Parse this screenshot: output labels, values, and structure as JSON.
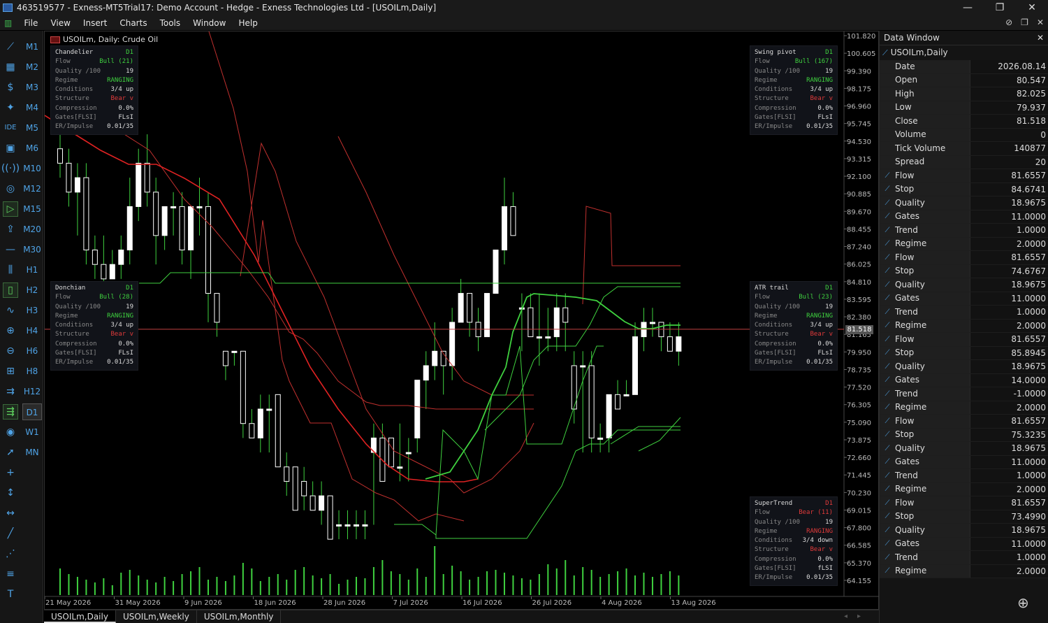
{
  "window": {
    "title": "463519577 - Exness-MT5Trial17: Demo Account - Hedge - Exness Technologies Ltd - [USOILm,Daily]",
    "controls": [
      "—",
      "❐",
      "✕"
    ]
  },
  "menu": {
    "items": [
      "File",
      "View",
      "Insert",
      "Charts",
      "Tools",
      "Window",
      "Help"
    ]
  },
  "toolbar": {
    "timeframes": [
      "M1",
      "M2",
      "M3",
      "M4",
      "M5",
      "M6",
      "M10",
      "M12",
      "M15",
      "M20",
      "M30",
      "H1",
      "H2",
      "H3",
      "H4",
      "H6",
      "H8",
      "H12",
      "D1",
      "W1",
      "MN"
    ],
    "active_timeframe": "D1",
    "ide_label": "IDE"
  },
  "chart": {
    "symbol_label": "USOILm, Daily:  Crude Oil",
    "current_price": "81.518",
    "price_labels": [
      "101.820",
      "100.605",
      "99.390",
      "98.175",
      "96.960",
      "95.745",
      "94.530",
      "93.315",
      "92.100",
      "90.885",
      "89.670",
      "88.455",
      "87.240",
      "86.025",
      "84.810",
      "83.595",
      "82.380",
      "81.165",
      "79.950",
      "78.735",
      "77.520",
      "76.305",
      "75.090",
      "73.875",
      "72.660",
      "71.445",
      "70.230",
      "69.015",
      "67.800",
      "66.585",
      "65.370",
      "64.155"
    ],
    "date_labels": [
      "21 May 2026",
      "31 May 2026",
      "9 Jun 2026",
      "18 Jun 2026",
      "28 Jun 2026",
      "7 Jul 2026",
      "16 Jul 2026",
      "26 Jul 2026",
      "4 Aug 2026",
      "13 Aug 2026"
    ],
    "colors": {
      "bull": "#ffffff",
      "bear": "#ffffff",
      "wick": "#3fd13f",
      "red_line": "#e03a3a",
      "green_line": "#3fd13f",
      "volume": "#3fd13f"
    }
  },
  "panels": [
    {
      "title": "Chandelier",
      "tf": "D1",
      "flow": "Bull (21)",
      "flow_color": "green",
      "quality": "19",
      "regime": "RANGING",
      "regime_color": "green",
      "conditions": "3/4 up",
      "structure": "Bear v",
      "compression": "0.0%",
      "gates": "FLsI",
      "er": "0.01/35"
    },
    {
      "title": "Swing pivot",
      "tf": "D1",
      "flow": "Bull (167)",
      "flow_color": "green",
      "quality": "19",
      "regime": "RANGING",
      "regime_color": "green",
      "conditions": "3/4 up",
      "structure": "Bear v",
      "compression": "0.0%",
      "gates": "FLsI",
      "er": "0.01/35"
    },
    {
      "title": "Donchian",
      "tf": "D1",
      "flow": "Bull (28)",
      "flow_color": "green",
      "quality": "19",
      "regime": "RANGING",
      "regime_color": "green",
      "conditions": "3/4 up",
      "structure": "Bear v",
      "compression": "0.0%",
      "gates": "FLsI",
      "er": "0.01/35"
    },
    {
      "title": "ATR trail",
      "tf": "D1",
      "flow": "Bull (23)",
      "flow_color": "green",
      "quality": "19",
      "regime": "RANGING",
      "regime_color": "green",
      "conditions": "3/4 up",
      "structure": "Bear v",
      "compression": "0.0%",
      "gates": "FLsI",
      "er": "0.01/35"
    },
    {
      "title": "SuperTrend",
      "tf": "D1",
      "flow": "Bear (11)",
      "flow_color": "red",
      "quality": "19",
      "regime": "RANGING",
      "regime_color": "red",
      "conditions": "3/4 down",
      "structure": "Bear v",
      "compression": "0.0%",
      "gates": "fLSI",
      "er": "0.01/35"
    }
  ],
  "panel_labels": {
    "flow": "Flow",
    "quality": "Quality /100",
    "regime": "Regime",
    "conditions": "Conditions",
    "structure": "Structure",
    "compression": "Compression",
    "gates": "Gates[FLSI]",
    "er": "ER/Impulse"
  },
  "tabs": [
    "USOILm,Daily",
    "USOILm,Weekly",
    "USOILm,Monthly"
  ],
  "data_window": {
    "title": "Data Window",
    "close": "✕",
    "symbol": "USOILm,Daily",
    "rows": [
      {
        "k": "Date",
        "v": "2026.08.14",
        "icon": ""
      },
      {
        "k": "Open",
        "v": "80.547",
        "icon": ""
      },
      {
        "k": "High",
        "v": "82.025",
        "icon": ""
      },
      {
        "k": "Low",
        "v": "79.937",
        "icon": ""
      },
      {
        "k": "Close",
        "v": "81.518",
        "icon": ""
      },
      {
        "k": "Volume",
        "v": "0",
        "icon": ""
      },
      {
        "k": "Tick Volume",
        "v": "140877",
        "icon": ""
      },
      {
        "k": "Spread",
        "v": "20",
        "icon": ""
      },
      {
        "k": "Flow",
        "v": "81.6557",
        "icon": "ind"
      },
      {
        "k": "Stop",
        "v": "84.6741",
        "icon": "ind"
      },
      {
        "k": "Quality",
        "v": "18.9675",
        "icon": "ind"
      },
      {
        "k": "Gates",
        "v": "11.0000",
        "icon": "ind"
      },
      {
        "k": "Trend",
        "v": "1.0000",
        "icon": "ind"
      },
      {
        "k": "Regime",
        "v": "2.0000",
        "icon": "ind"
      },
      {
        "k": "Flow",
        "v": "81.6557",
        "icon": "ind"
      },
      {
        "k": "Stop",
        "v": "74.6767",
        "icon": "ind"
      },
      {
        "k": "Quality",
        "v": "18.9675",
        "icon": "ind"
      },
      {
        "k": "Gates",
        "v": "11.0000",
        "icon": "ind"
      },
      {
        "k": "Trend",
        "v": "1.0000",
        "icon": "ind"
      },
      {
        "k": "Regime",
        "v": "2.0000",
        "icon": "ind"
      },
      {
        "k": "Flow",
        "v": "81.6557",
        "icon": "ind"
      },
      {
        "k": "Stop",
        "v": "85.8945",
        "icon": "ind"
      },
      {
        "k": "Quality",
        "v": "18.9675",
        "icon": "ind"
      },
      {
        "k": "Gates",
        "v": "14.0000",
        "icon": "ind"
      },
      {
        "k": "Trend",
        "v": "-1.0000",
        "icon": "ind"
      },
      {
        "k": "Regime",
        "v": "2.0000",
        "icon": "ind"
      },
      {
        "k": "Flow",
        "v": "81.6557",
        "icon": "ind"
      },
      {
        "k": "Stop",
        "v": "75.3235",
        "icon": "ind"
      },
      {
        "k": "Quality",
        "v": "18.9675",
        "icon": "ind"
      },
      {
        "k": "Gates",
        "v": "11.0000",
        "icon": "ind"
      },
      {
        "k": "Trend",
        "v": "1.0000",
        "icon": "ind"
      },
      {
        "k": "Regime",
        "v": "2.0000",
        "icon": "ind"
      },
      {
        "k": "Flow",
        "v": "81.6557",
        "icon": "ind"
      },
      {
        "k": "Stop",
        "v": "73.4990",
        "icon": "ind"
      },
      {
        "k": "Quality",
        "v": "18.9675",
        "icon": "ind"
      },
      {
        "k": "Gates",
        "v": "11.0000",
        "icon": "ind"
      },
      {
        "k": "Trend",
        "v": "1.0000",
        "icon": "ind"
      },
      {
        "k": "Regime",
        "v": "2.0000",
        "icon": "ind"
      }
    ]
  },
  "candles": [
    [
      94,
      96,
      92,
      93
    ],
    [
      93,
      94,
      90,
      91
    ],
    [
      91,
      93,
      88,
      92
    ],
    [
      92,
      93,
      86,
      87
    ],
    [
      87,
      88,
      85,
      86
    ],
    [
      86,
      88,
      84,
      85
    ],
    [
      85,
      87,
      85,
      86
    ],
    [
      86,
      88,
      85,
      87
    ],
    [
      87,
      92,
      86,
      90
    ],
    [
      90,
      94,
      89,
      93
    ],
    [
      93,
      95,
      90,
      91
    ],
    [
      91,
      92,
      86,
      88
    ],
    [
      88,
      90,
      87,
      90
    ],
    [
      90,
      91,
      88,
      90
    ],
    [
      90,
      91,
      86,
      87
    ],
    [
      87,
      90,
      85,
      90
    ],
    [
      90,
      92,
      88,
      90
    ],
    [
      90,
      91,
      82,
      84
    ],
    [
      84,
      84,
      81,
      82
    ],
    [
      80,
      80,
      78,
      79
    ],
    [
      80,
      80,
      79,
      80
    ],
    [
      80,
      80,
      74,
      75
    ],
    [
      75,
      76,
      74,
      74
    ],
    [
      74,
      77,
      73,
      76
    ],
    [
      76,
      77,
      73,
      76
    ],
    [
      77,
      77,
      72,
      72
    ],
    [
      72,
      73,
      70,
      71
    ],
    [
      72,
      72,
      69,
      69
    ],
    [
      71,
      72,
      69,
      70
    ],
    [
      70,
      71,
      69,
      69
    ],
    [
      69,
      71,
      68,
      70
    ],
    [
      70,
      70,
      67,
      67
    ],
    [
      68,
      69,
      67,
      68
    ],
    [
      68,
      69,
      67,
      68
    ],
    [
      68,
      69,
      67,
      68
    ],
    [
      68,
      69,
      67,
      68
    ],
    [
      73,
      75,
      68,
      74
    ],
    [
      74,
      75,
      71,
      71
    ],
    [
      74,
      74,
      72,
      72
    ],
    [
      72,
      75,
      71,
      72
    ],
    [
      73,
      74,
      71,
      73
    ],
    [
      74,
      78,
      73,
      78
    ],
    [
      78,
      80,
      76,
      79
    ],
    [
      79,
      82,
      78,
      80
    ],
    [
      80,
      80,
      77,
      79
    ],
    [
      79,
      83,
      78,
      82
    ],
    [
      82,
      85,
      82,
      84
    ],
    [
      84,
      84,
      81,
      82
    ],
    [
      82,
      83,
      80,
      81
    ],
    [
      81,
      84,
      81,
      84
    ],
    [
      84,
      87,
      84,
      87
    ],
    [
      87,
      92,
      86,
      90
    ],
    [
      90,
      91,
      88,
      88
    ],
    [
      83,
      84,
      80,
      83
    ],
    [
      83,
      84,
      81,
      81
    ],
    [
      81,
      84,
      79,
      81
    ],
    [
      81,
      83,
      80,
      81
    ],
    [
      81,
      84,
      80,
      83
    ],
    [
      83,
      84,
      80,
      82
    ],
    [
      79,
      80,
      75,
      76
    ],
    [
      79,
      80,
      73,
      79
    ],
    [
      79,
      80,
      73,
      74
    ],
    [
      74,
      75,
      73,
      74
    ],
    [
      74,
      77,
      73,
      77
    ],
    [
      77,
      78,
      76,
      76
    ],
    [
      77,
      78,
      77,
      77
    ],
    [
      77,
      82,
      77,
      81
    ],
    [
      81,
      83,
      80,
      82
    ],
    [
      82,
      83,
      81,
      82
    ],
    [
      82,
      82,
      80,
      81
    ],
    [
      81,
      82,
      80,
      80
    ],
    [
      80,
      82,
      79,
      81
    ]
  ]
}
